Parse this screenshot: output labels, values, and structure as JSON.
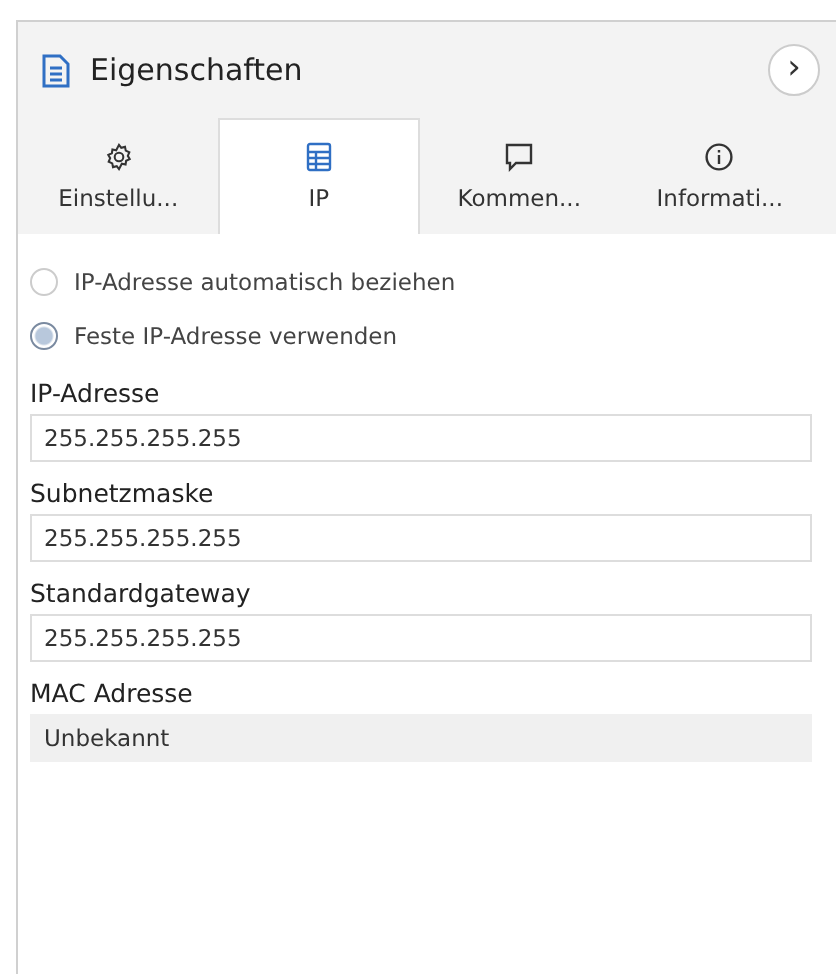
{
  "panel": {
    "title": "Eigenschaften",
    "collapse_button": "›"
  },
  "tabs": [
    {
      "label": "Einstellu...",
      "kind": "settings",
      "selected": false
    },
    {
      "label": "IP",
      "kind": "network",
      "selected": true
    },
    {
      "label": "Kommen...",
      "kind": "comments",
      "selected": false
    },
    {
      "label": "Informati...",
      "kind": "information",
      "selected": false
    }
  ],
  "ip_mode": [
    {
      "label": "IP-Adresse automatisch beziehen",
      "selected": false
    },
    {
      "label": "Feste IP-Adresse verwenden",
      "selected": true
    }
  ],
  "fields": [
    {
      "label": "IP-Adresse",
      "value": "255.255.255.255",
      "readonly": false
    },
    {
      "label": "Subnetzmaske",
      "value": "255.255.255.255",
      "readonly": false
    },
    {
      "label": "Standardgateway",
      "value": "255.255.255.255",
      "readonly": false
    },
    {
      "label": "MAC Adresse",
      "value": "Unbekannt",
      "readonly": true
    }
  ]
}
